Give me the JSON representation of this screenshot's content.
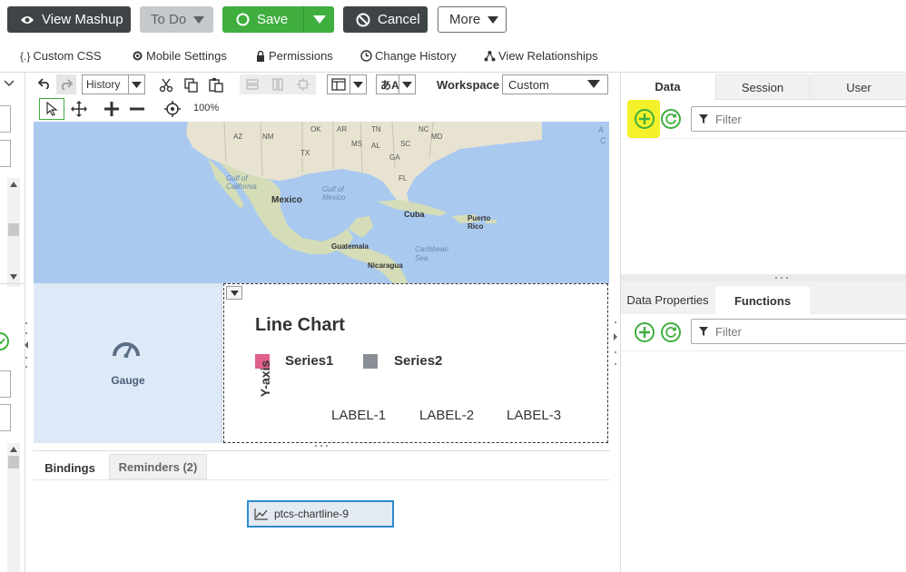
{
  "toolbar": {
    "view_mashup": "View Mashup",
    "todo": "To Do",
    "save": "Save",
    "cancel": "Cancel",
    "more": "More"
  },
  "subtoolbar": {
    "custom_css": "Custom CSS",
    "mobile_settings": "Mobile Settings",
    "permissions": "Permissions",
    "change_history": "Change History",
    "view_relationships": "View Relationships"
  },
  "canvas_toolbar": {
    "history_label": "History",
    "workspace_label": "Workspace",
    "workspace_value": "Custom",
    "zoom": "100%"
  },
  "map": {
    "labels": [
      "OK",
      "AR",
      "TN",
      "NC",
      "SC",
      "MD",
      "AZ",
      "NM",
      "MS",
      "AL",
      "GA",
      "TX",
      "FL",
      "Gulf of California",
      "Mexico",
      "Gulf of Mexico",
      "Cuba",
      "Puerto Rico",
      "Guatemala",
      "Caribbean Sea",
      "Nicaragua"
    ]
  },
  "gauge_widget": {
    "label": "Gauge"
  },
  "line_chart": {
    "title": "Line Chart",
    "series1": "Series1",
    "series2": "Series2",
    "yaxis": "Y-axis",
    "labels": [
      "LABEL-1",
      "LABEL-2",
      "LABEL-3"
    ],
    "colors": {
      "series1": "#e0608a",
      "series2": "#8a8f96"
    }
  },
  "bottom_tabs": {
    "bindings": "Bindings",
    "reminders": "Reminders (2)"
  },
  "binding_chip": {
    "label": "ptcs-chartline-9"
  },
  "right_panel": {
    "tabs": [
      "Data",
      "Session",
      "User"
    ],
    "filter_placeholder": "Filter",
    "lower_tabs": [
      "Data Properties",
      "Functions"
    ],
    "functions_filter_placeholder": "Filter"
  },
  "colors": {
    "dark_button": "#3f4447",
    "green": "#3fae3f",
    "highlight": "#f4f12a"
  }
}
